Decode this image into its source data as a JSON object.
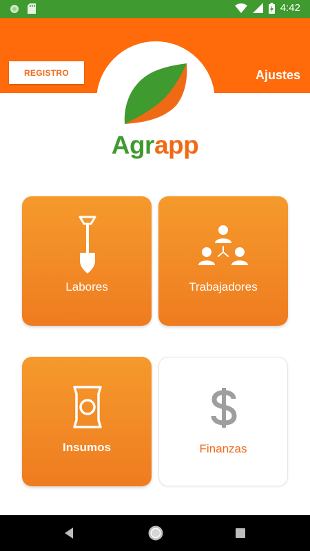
{
  "status_bar": {
    "time": "4:42",
    "icons": [
      "circle-notification-icon",
      "sd-card-icon",
      "wifi-icon",
      "signal-icon",
      "battery-charging-icon"
    ]
  },
  "header": {
    "registro_label": "REGISTRO",
    "ajustes_label": "Ajustes"
  },
  "logo": {
    "part1": "Agr",
    "part2": "app",
    "colors": {
      "green": "#3f9a2f",
      "orange": "#f06a16"
    }
  },
  "tiles": [
    {
      "label": "Labores",
      "icon": "shovel-icon",
      "style": "orange"
    },
    {
      "label": "Trabajadores",
      "icon": "workers-icon",
      "style": "orange"
    },
    {
      "label": "Insumos",
      "icon": "supply-bag-icon",
      "style": "orange"
    },
    {
      "label": "Finanzas",
      "icon": "dollar-icon",
      "style": "white"
    }
  ],
  "nav": {
    "icons": [
      "back-icon",
      "home-icon",
      "recents-icon"
    ]
  },
  "colors": {
    "status_bar": "#3f9a2f",
    "header": "#ff6a0a",
    "tile_orange": "#f28a26",
    "finanzas_label": "#ef6b1b",
    "dollar_gray": "#9e9e9e"
  }
}
